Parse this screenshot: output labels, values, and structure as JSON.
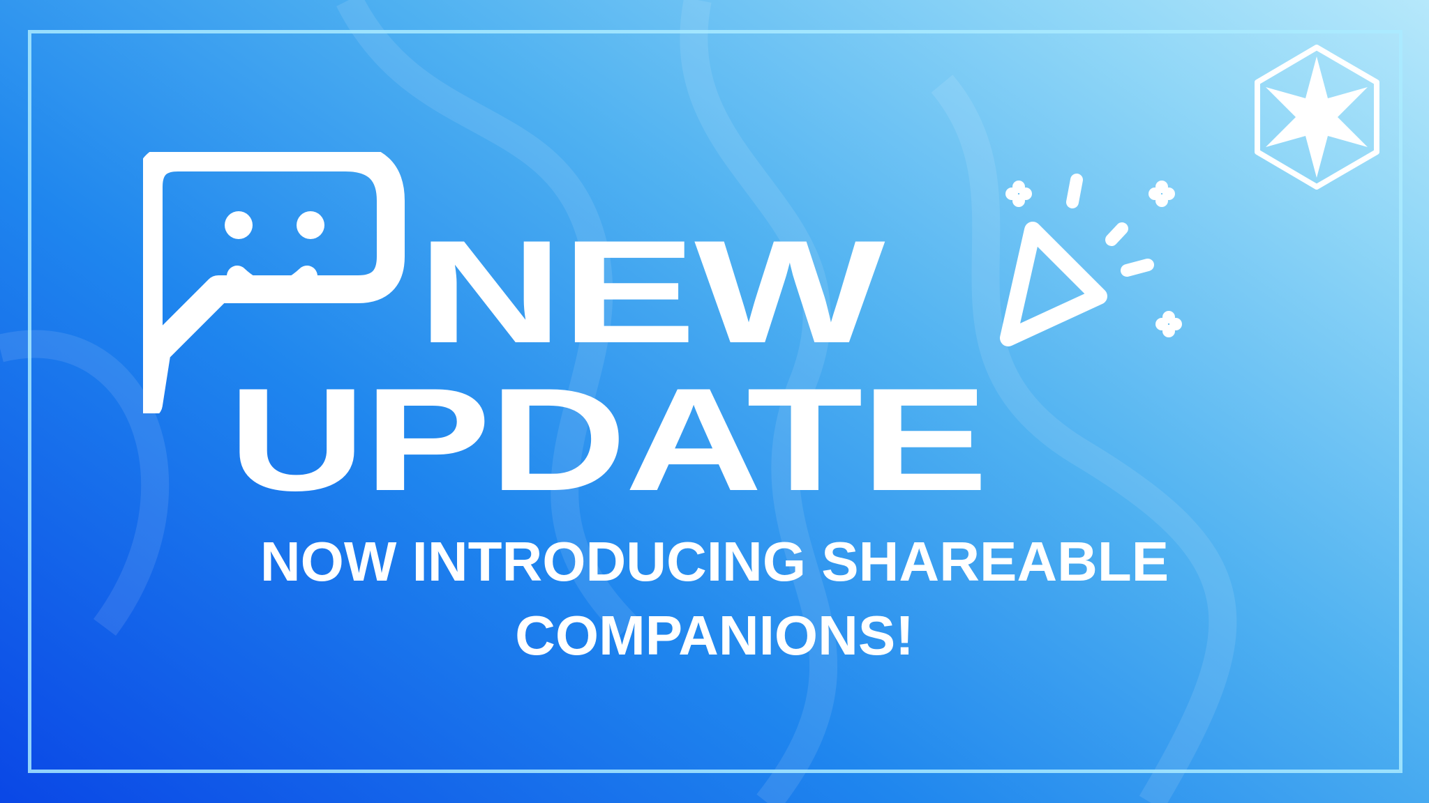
{
  "banner": {
    "heading_line1": "NEW",
    "heading_line2": "UPDATE",
    "subtitle_line1": "NOW INTRODUCING SHAREABLE",
    "subtitle_line2": "COMPANIONS!"
  },
  "icons": {
    "chat": "smiling-chat-bubble-icon",
    "party": "party-popper-icon",
    "logo": "hexagon-star-logo"
  },
  "colors": {
    "text": "#ffffff",
    "background_dark": "#0a47e6",
    "background_light": "#b6e8fb",
    "frame": "#aaebff"
  }
}
